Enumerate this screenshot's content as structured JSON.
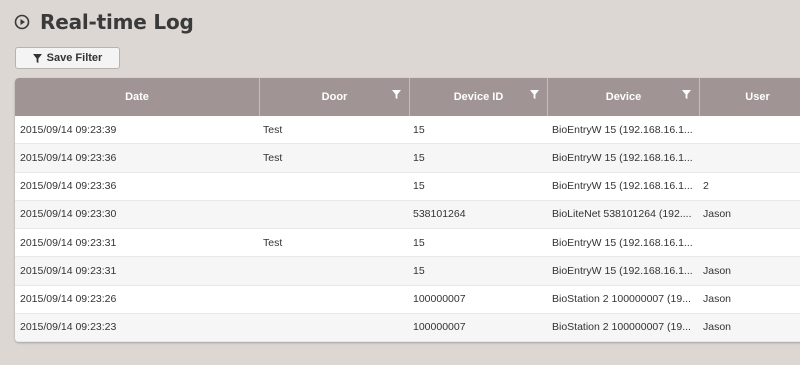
{
  "page": {
    "title": "Real-time Log"
  },
  "toolbar": {
    "save_filter_label": "Save Filter"
  },
  "table": {
    "columns": {
      "date": "Date",
      "door": "Door",
      "device_id": "Device ID",
      "device": "Device",
      "user": "User"
    },
    "rows": [
      {
        "date": "2015/09/14 09:23:39",
        "door": "Test",
        "device_id": "15",
        "device": "BioEntryW 15 (192.168.16.1...",
        "user": ""
      },
      {
        "date": "2015/09/14 09:23:36",
        "door": "Test",
        "device_id": "15",
        "device": "BioEntryW 15 (192.168.16.1...",
        "user": ""
      },
      {
        "date": "2015/09/14 09:23:36",
        "door": "",
        "device_id": "15",
        "device": "BioEntryW 15 (192.168.16.1...",
        "user": "2"
      },
      {
        "date": "2015/09/14 09:23:30",
        "door": "",
        "device_id": "538101264",
        "device": "BioLiteNet 538101264 (192....",
        "user": "Jason"
      },
      {
        "date": "2015/09/14 09:23:31",
        "door": "Test",
        "device_id": "15",
        "device": "BioEntryW 15 (192.168.16.1...",
        "user": ""
      },
      {
        "date": "2015/09/14 09:23:31",
        "door": "",
        "device_id": "15",
        "device": "BioEntryW 15 (192.168.16.1...",
        "user": "Jason"
      },
      {
        "date": "2015/09/14 09:23:26",
        "door": "",
        "device_id": "100000007",
        "device": "BioStation 2 100000007 (19...",
        "user": "Jason"
      },
      {
        "date": "2015/09/14 09:23:23",
        "door": "",
        "device_id": "100000007",
        "device": "BioStation 2 100000007 (19...",
        "user": "Jason"
      }
    ]
  },
  "icons": {
    "title_icon": "play-circle-icon",
    "filter_icon": "filter-icon"
  },
  "colors": {
    "background": "#dcd7d3",
    "header": "#a09594",
    "title": "#3a3a3a"
  }
}
